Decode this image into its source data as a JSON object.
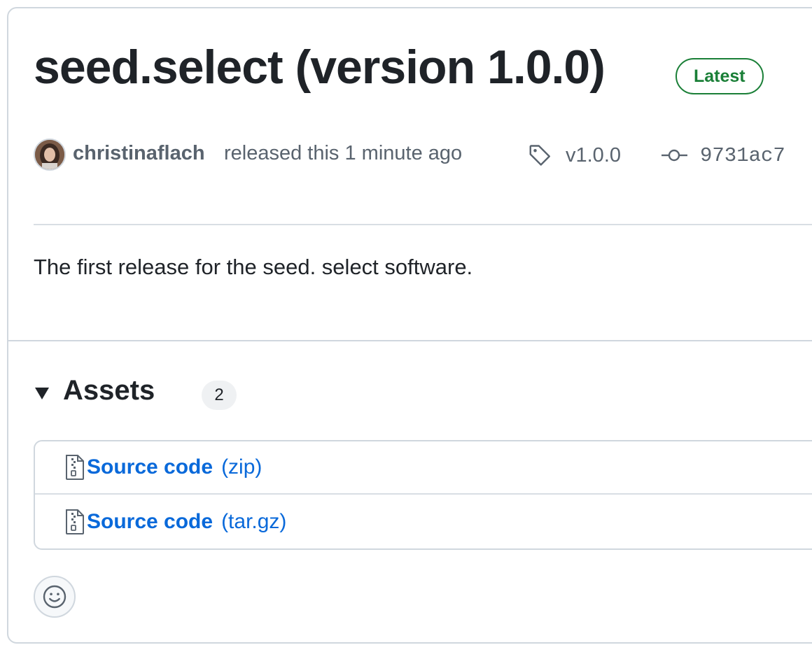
{
  "release": {
    "title": "seed.select (version 1.0.0)",
    "badge": "Latest",
    "author": "christinaflach",
    "released_text": "released this 1 minute ago",
    "tag": "v1.0.0",
    "commit": "9731ac7",
    "body": "The first release for the seed. select software."
  },
  "assets": {
    "title": "Assets",
    "count": "2",
    "items": [
      {
        "name": "Source code",
        "ext": "(zip)"
      },
      {
        "name": "Source code",
        "ext": "(tar.gz)"
      }
    ]
  },
  "icons": {
    "tag": "tag-icon",
    "commit": "git-commit-icon",
    "file": "file-zip-icon",
    "reaction": "smiley-icon",
    "expand": "triangle-down-icon"
  },
  "colors": {
    "badge_green": "#1a7f37",
    "link_blue": "#0969da",
    "muted_text": "#59636e",
    "border": "#d0d7de"
  }
}
